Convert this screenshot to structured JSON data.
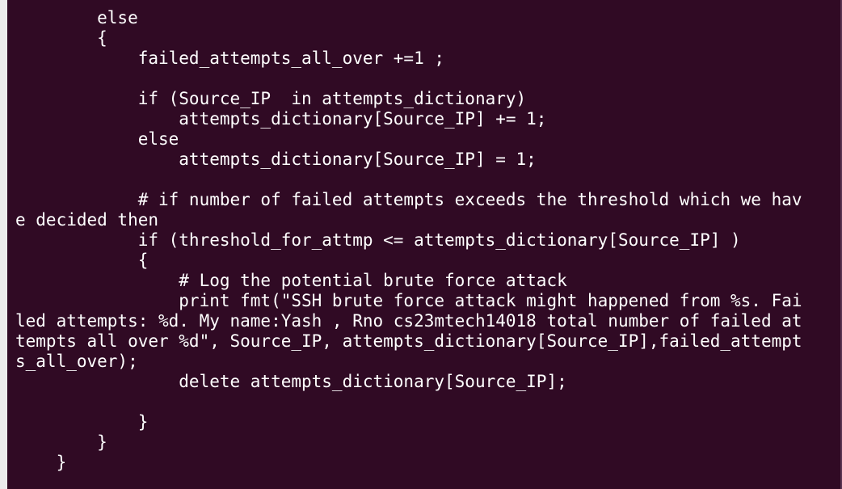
{
  "terminal": {
    "lines": [
      "        else",
      "        {",
      "            failed_attempts_all_over +=1 ;",
      "",
      "            if (Source_IP  in attempts_dictionary)",
      "                attempts_dictionary[Source_IP] += 1;",
      "            else",
      "                attempts_dictionary[Source_IP] = 1;",
      "",
      "            # if number of failed attempts exceeds the threshold which we hav",
      "e decided then",
      "            if (threshold_for_attmp <= attempts_dictionary[Source_IP] )",
      "            {",
      "                # Log the potential brute force attack",
      "                print fmt(\"SSH brute force attack might happened from %s. Fai",
      "led attempts: %d. My name:Yash , Rno cs23mtech14018 total number of failed at",
      "tempts all over %d\", Source_IP, attempts_dictionary[Source_IP],failed_attempt",
      "s_all_over);",
      "                delete attempts_dictionary[Source_IP];",
      "",
      "            }",
      "        }",
      "    }"
    ]
  }
}
